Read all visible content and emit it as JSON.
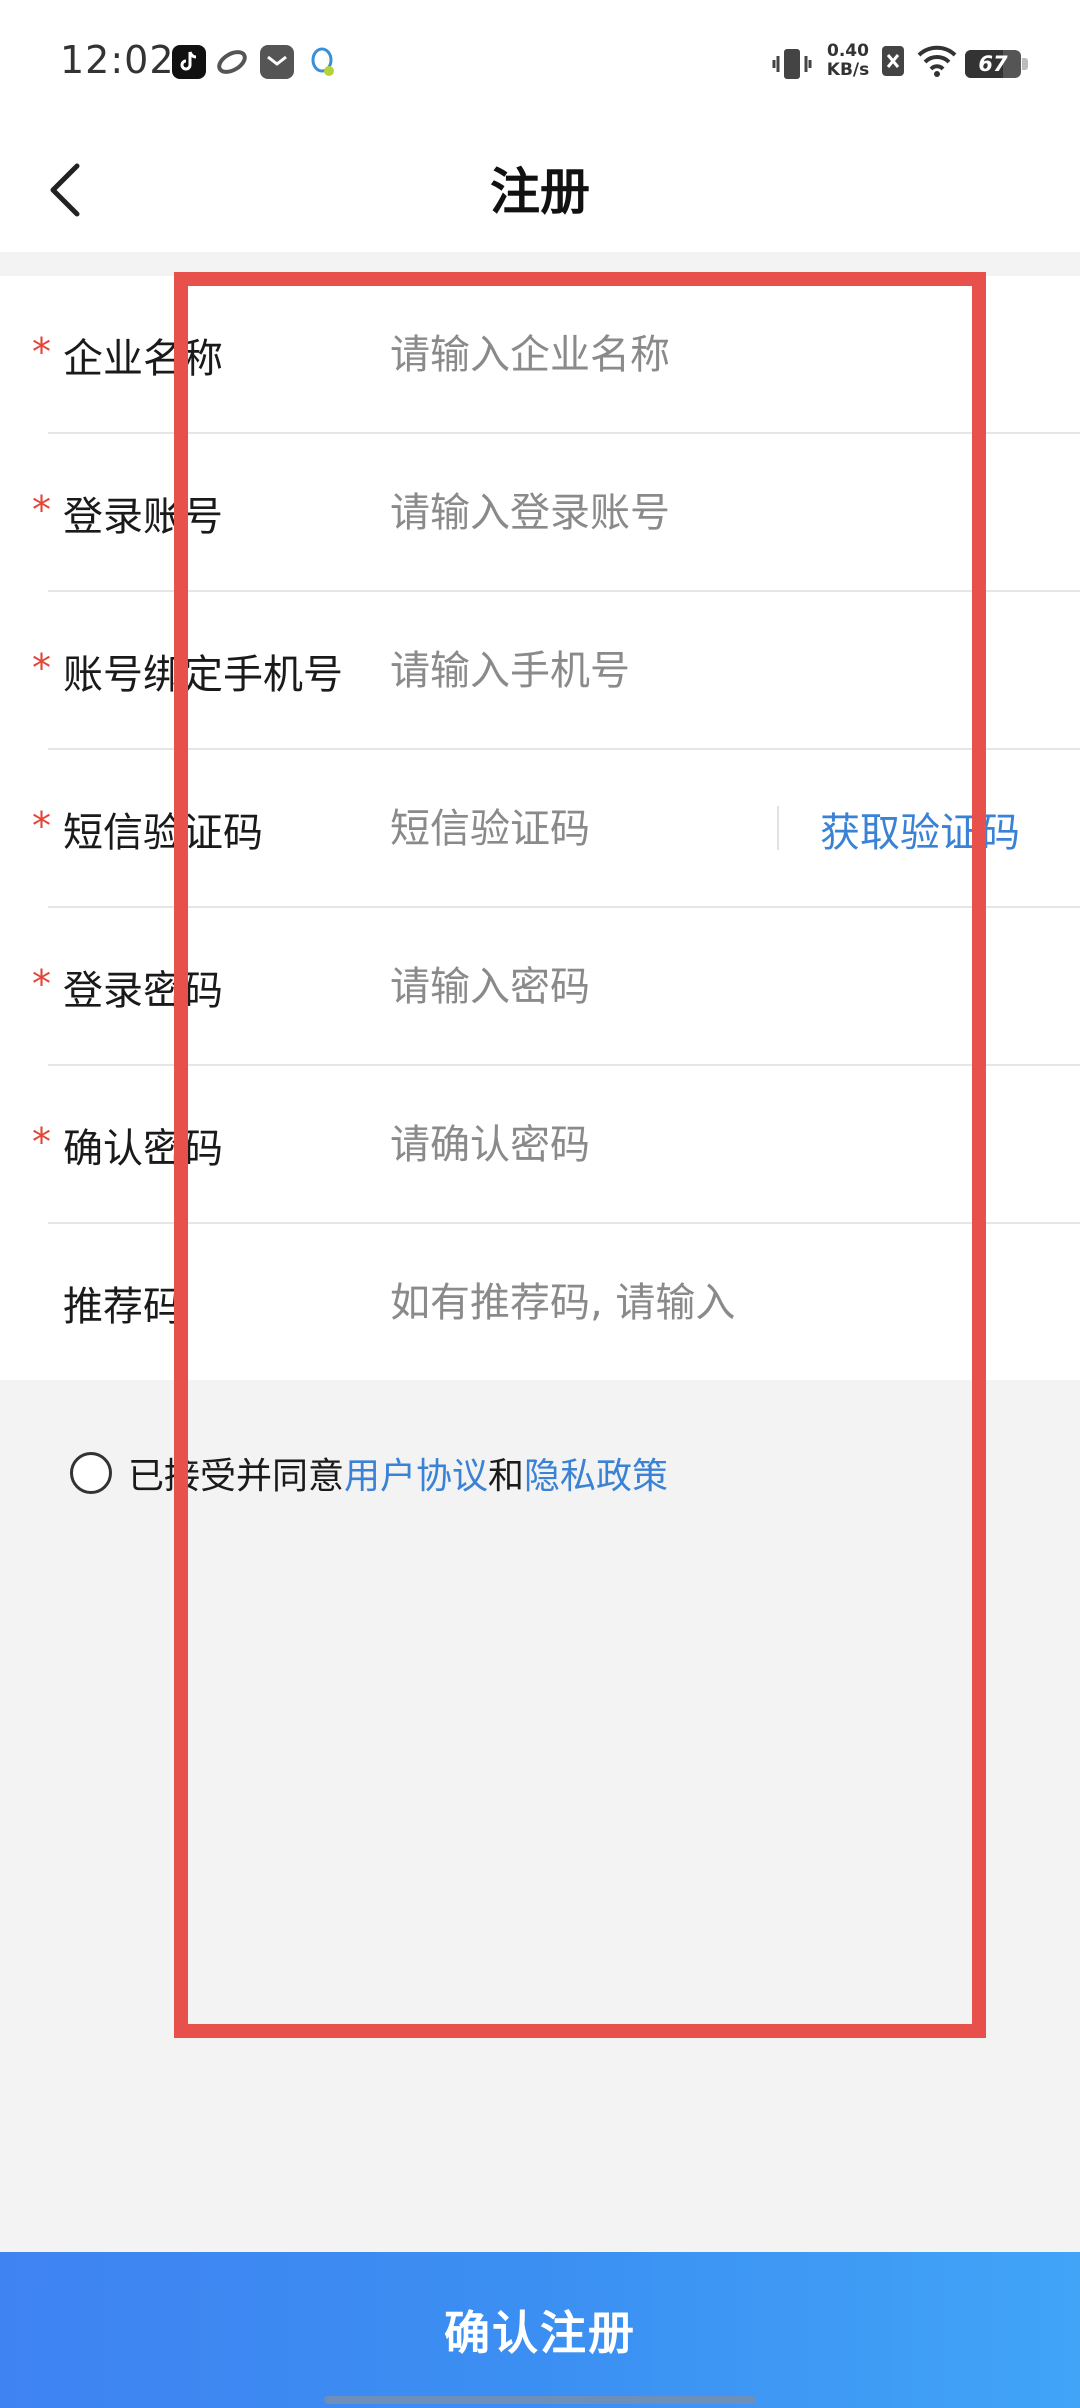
{
  "status_bar": {
    "time": "12:02",
    "net_speed_value": "0.40",
    "net_speed_unit": "KB/s",
    "battery_level": "67",
    "app_icons": [
      "tiktok-icon",
      "browser-icon",
      "mail-icon",
      "qq-icon"
    ],
    "right_icons": [
      "vibrate-icon",
      "no-sim-icon",
      "wifi-icon",
      "battery-icon"
    ]
  },
  "header": {
    "title": "注册",
    "back_icon": "chevron-left-icon"
  },
  "form": {
    "fields": [
      {
        "label": "企业名称",
        "required": true,
        "placeholder": "请输入企业名称",
        "value": ""
      },
      {
        "label": "登录账号",
        "required": true,
        "placeholder": "请输入登录账号",
        "value": ""
      },
      {
        "label": "账号绑定手机号",
        "required": true,
        "placeholder": "请输入手机号",
        "value": ""
      },
      {
        "label": "短信验证码",
        "required": true,
        "placeholder": "短信验证码",
        "value": ""
      },
      {
        "label": "登录密码",
        "required": true,
        "placeholder": "请输入密码",
        "value": ""
      },
      {
        "label": "确认密码",
        "required": true,
        "placeholder": "请确认密码",
        "value": ""
      },
      {
        "label": "推荐码",
        "required": false,
        "placeholder": "如有推荐码, 请输入",
        "value": ""
      }
    ],
    "required_marker": "*",
    "get_code_label": "获取验证码"
  },
  "agreement": {
    "prefix": "已接受并同意",
    "user_agreement": "用户协议",
    "conjunction": "和",
    "privacy_policy": "隐私政策",
    "checked": false
  },
  "footer": {
    "confirm_label": "确认注册"
  },
  "colors": {
    "accent": "#3a82d6",
    "required": "#e0473a",
    "button_gradient_start": "#3f83f2",
    "button_gradient_end": "#41a4f7",
    "annotation": "#e8504c"
  }
}
